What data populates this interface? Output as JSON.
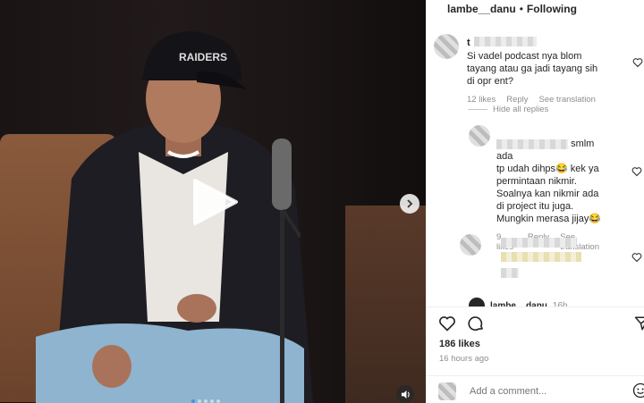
{
  "header": {
    "username": "lambe__danu",
    "separator": "•",
    "follow_status": "Following"
  },
  "comments": [
    {
      "username_prefix": "t",
      "text": "Si vadel podcast nya blom tayang atau ga jadi tayang sih di opr ent?",
      "likes": "12 likes",
      "reply": "Reply",
      "see_translation": "See translation"
    }
  ],
  "hide_replies": "Hide all replies",
  "replies": [
    {
      "text_a": "smlm ada",
      "text_b": "tp udah dihps😂 kek ya permintaan nikmir. Soalnya kan nikmir ada di project itu juga. Mungkin merasa jijay😂",
      "likes": "9 likes",
      "reply": "Reply",
      "see_translation": "See translation"
    }
  ],
  "owner_reply": {
    "username": "lambe__danu",
    "time": "16h"
  },
  "post": {
    "likes": "186 likes",
    "time_ago": "16 hours ago",
    "add_comment_placeholder": "Add a comment..."
  },
  "media": {
    "cap_text": "RAIDERS",
    "active_dot": 0,
    "dot_count": 5
  },
  "icons": {
    "heart": "heart-icon",
    "comment": "comment-icon",
    "share": "share-icon",
    "play": "play-icon",
    "next": "chevron-right-icon",
    "mute": "speaker-icon",
    "emoji": "smile-icon"
  },
  "colors": {
    "link_blue": "#3897f0",
    "muted_gray": "#8e8e8e",
    "text": "#262626"
  }
}
